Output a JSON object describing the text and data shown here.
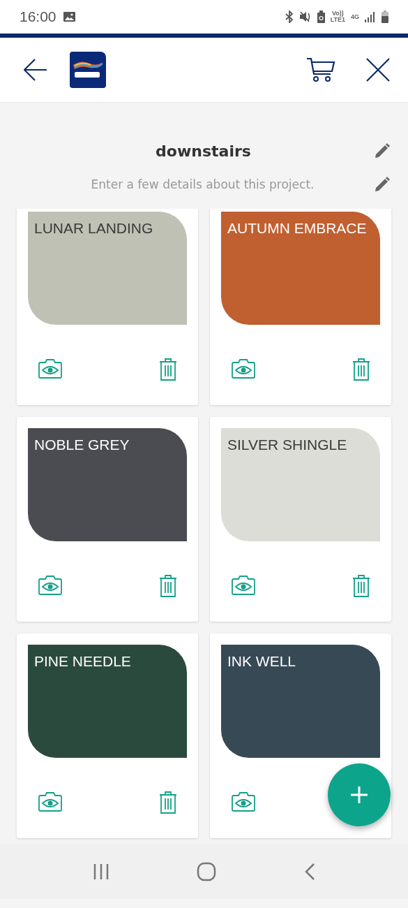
{
  "status_bar": {
    "time": "16:00",
    "volte": "Vo))",
    "lte": "LTE1",
    "network": "4G"
  },
  "project": {
    "title": "downstairs",
    "description_placeholder": "Enter a few details about this project."
  },
  "cards": [
    {
      "name": "LUNAR LANDING",
      "color": "#c0c1b5",
      "delete_icon": true
    },
    {
      "name": "AUTUMN EMBRACE",
      "color": "#c05f30",
      "delete_icon": true
    },
    {
      "name": "NOBLE GREY",
      "color": "#4b4c51",
      "delete_icon": true
    },
    {
      "name": "SILVER SHINGLE",
      "color": "#dcddd7",
      "delete_icon": true
    },
    {
      "name": "PINE NEEDLE",
      "color": "#2b4a3e",
      "delete_icon": true
    },
    {
      "name": "INK WELL",
      "color": "#374955",
      "delete_icon": false
    }
  ]
}
